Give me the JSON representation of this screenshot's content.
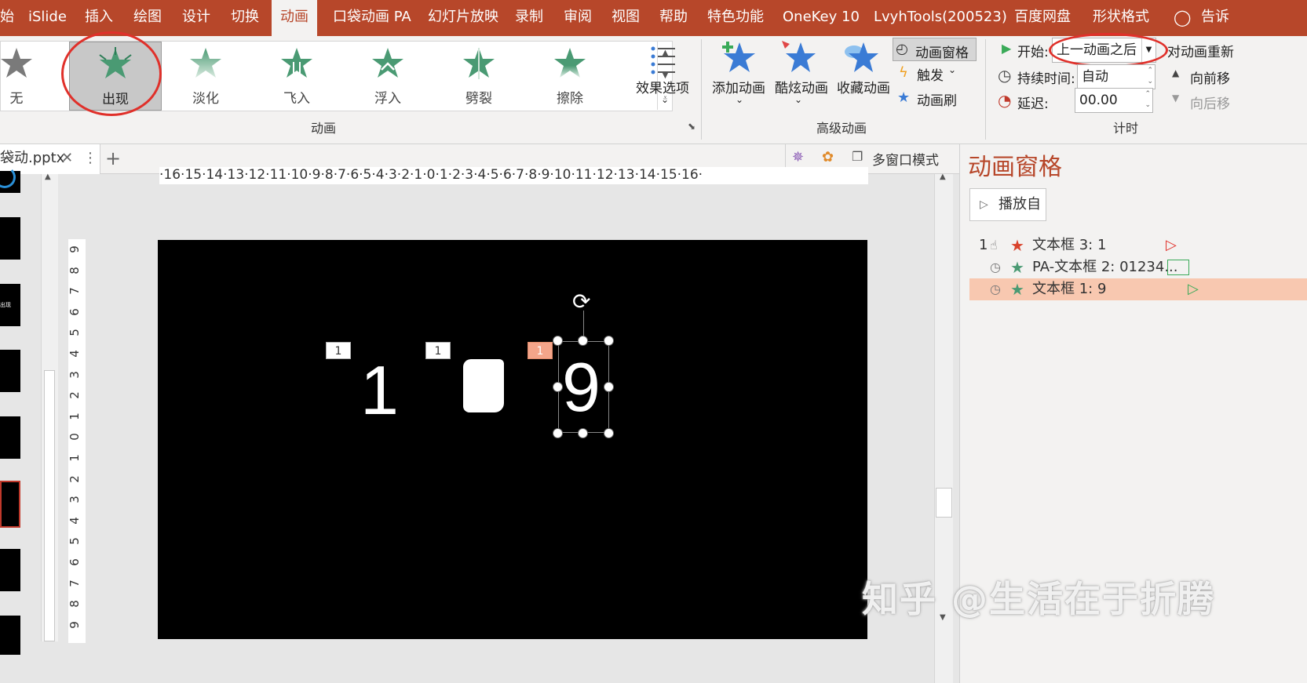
{
  "menubar": {
    "items": [
      "始",
      "iSlide",
      "插入",
      "绘图",
      "设计",
      "切换",
      "动画",
      "口袋动画 PA",
      "幻灯片放映",
      "录制",
      "审阅",
      "视图",
      "帮助",
      "特色功能",
      "OneKey 10",
      "LvyhTools(200523)",
      "百度网盘",
      "形状格式",
      "告诉"
    ],
    "active": "动画"
  },
  "ribbon": {
    "animations": [
      {
        "label": "无",
        "icon": "star-gray-icon"
      },
      {
        "label": "出现",
        "icon": "star-burst-icon"
      },
      {
        "label": "淡化",
        "icon": "star-fade-icon"
      },
      {
        "label": "飞入",
        "icon": "star-flyin-icon"
      },
      {
        "label": "浮入",
        "icon": "star-floatin-icon"
      },
      {
        "label": "劈裂",
        "icon": "star-split-icon"
      },
      {
        "label": "擦除",
        "icon": "star-wipe-icon"
      }
    ],
    "selected_animation": "出现",
    "effect_options": "效果选项",
    "group_animation": "动画",
    "add_animation": "添加动画",
    "cool_animation": "酷炫动画",
    "fav_animation": "收藏动画",
    "animation_pane": "动画窗格",
    "trigger": "触发",
    "animation_painter": "动画刷",
    "group_advanced": "高级动画",
    "start_label": "开始:",
    "start_value": "上一动画之后",
    "duration_label": "持续时间:",
    "duration_value": "自动",
    "delay_label": "延迟:",
    "delay_value": "00.00",
    "reorder_label": "对动画重新",
    "move_forward": "向前移",
    "move_back": "向后移",
    "group_timing": "计时"
  },
  "tabs": {
    "doc_name": "袋动.pptx",
    "multiwindow": "多窗口模式"
  },
  "ruler": {
    "horizontal": "·16·15·14·13·12·11·10·9·8·7·6·5·4·3·2·1·0·1·2·3·4·5·6·7·8·9·10·11·12·13·14·15·16·",
    "vertical": [
      "9",
      "8",
      "7",
      "6",
      "5",
      "4",
      "3",
      "2",
      "1",
      "0",
      "1",
      "2",
      "3",
      "4",
      "5",
      "6",
      "7",
      "8",
      "9"
    ]
  },
  "slide": {
    "tags": [
      "1",
      "1",
      "1"
    ],
    "digit_left": "1",
    "digit_right": "9"
  },
  "pane": {
    "title": "动画窗格",
    "play_from": "播放自",
    "items": [
      {
        "index": "1",
        "name": "文本框 3: 1",
        "star_color": "#d9422b"
      },
      {
        "index": "",
        "name": "PA-文本框 2: 01234...",
        "star_color": "#4a9a73"
      },
      {
        "index": "",
        "name": "文本框 1: 9",
        "star_color": "#4a9a73"
      }
    ]
  },
  "watermark": "知乎 @生活在于折腾",
  "colors": {
    "accent": "#b7472a",
    "annotation": "#e0302a",
    "selection": "#f8c8b0"
  }
}
